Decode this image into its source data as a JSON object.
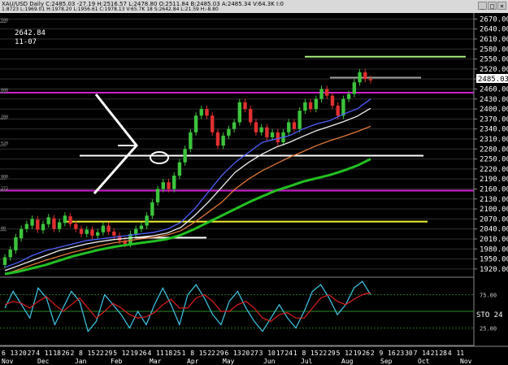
{
  "window": {
    "title": "XAU/USD Daily  C:2485.03  -27.19  H:2516.57  L:2478.80  O:2511.84  B:2485.03  A:2485.34  V:64.3K  I:0",
    "ohlc_line": "1:8723  L:1969.01  H:1978.20  L:1956.61  C:1978.13  V:65.7K  18  S:2642.84  L:21.59  H:-8.80",
    "buttons": [
      "_",
      "□",
      "×"
    ]
  },
  "info": {
    "price": "2642.84",
    "date": "11-07"
  },
  "left_stub_labels": [
    {
      "text": "500",
      "price": 2660
    },
    {
      "text": "808",
      "price": 2450
    },
    {
      "text": "208",
      "price": 2370
    },
    {
      "text": "520",
      "price": 2290
    },
    {
      "text": "900",
      "price": 2190
    },
    {
      "text": "272",
      "price": 2155
    },
    {
      "text": "00",
      "price": 2035
    }
  ],
  "colors": {
    "bg": "#000000",
    "grid": "#2e2e2e",
    "candle_up": "#3cc43c",
    "candle_down": "#e03030",
    "magenta": "#d020d0",
    "yellow": "#f4f430",
    "white": "#ffffff",
    "lime": "#a8f080",
    "gray": "#a0a0a0",
    "ma_green": "#22c022",
    "ma_orange": "#e07838",
    "ma_white": "#f0f0f0",
    "ma_blue": "#5060ff",
    "stoch_cyan": "#40c8e8",
    "stoch_red": "#e02020",
    "axis_text": "#ffffff"
  },
  "chart_data": {
    "type": "candlestick",
    "symbol": "XAU/USD",
    "timeframe": "Daily",
    "price_axis": {
      "ticks": [
        1920,
        1950,
        1980,
        2010,
        2040,
        2070,
        2100,
        2130,
        2160,
        2190,
        2220,
        2250,
        2280,
        2310,
        2340,
        2370,
        2400,
        2430,
        2460,
        2490,
        2520,
        2550,
        2580,
        2610,
        2640,
        2670
      ],
      "ylim": [
        1905,
        2688
      ],
      "last_price": "2485.03"
    },
    "x_axis": {
      "day_labels": [
        "6",
        "13",
        "20",
        "27",
        "4",
        "11",
        "18",
        "26",
        "2",
        "8",
        "15",
        "22",
        "29",
        "5",
        "12",
        "19",
        "26",
        "4",
        "11",
        "18",
        "25",
        "1",
        "8",
        "15",
        "22",
        "29",
        "6",
        "13",
        "20",
        "27",
        "3",
        "10",
        "17",
        "24",
        "1",
        "8",
        "15",
        "22",
        "29",
        "5",
        "12",
        "19",
        "26",
        "2",
        "9",
        "16",
        "23",
        "30",
        "7",
        "14",
        "21",
        "28",
        "4",
        "11"
      ],
      "month_labels": [
        "Nov",
        "Dec",
        "Jan",
        "Feb",
        "Mar",
        "Apr",
        "May",
        "Jun",
        "Jul",
        "Aug",
        "Sep",
        "Oct",
        "Nov"
      ]
    },
    "candles": [
      [
        1932,
        1955
      ],
      [
        1955,
        1978
      ],
      [
        1976,
        2015
      ],
      [
        2012,
        2040
      ],
      [
        2040,
        2055
      ],
      [
        2050,
        2070
      ],
      [
        2068,
        2038
      ],
      [
        2036,
        2055
      ],
      [
        2054,
        2075
      ],
      [
        2072,
        2040
      ],
      [
        2040,
        2060
      ],
      [
        2058,
        2080
      ],
      [
        2078,
        2055
      ],
      [
        2055,
        2040
      ],
      [
        2040,
        2025
      ],
      [
        2025,
        2038
      ],
      [
        2038,
        2020
      ],
      [
        2020,
        2030
      ],
      [
        2030,
        2050
      ],
      [
        2050,
        2032
      ],
      [
        2032,
        2020
      ],
      [
        2020,
        2005
      ],
      [
        2005,
        1995
      ],
      [
        1995,
        2025
      ],
      [
        2025,
        2040
      ],
      [
        2040,
        2050
      ],
      [
        2050,
        2080
      ],
      [
        2080,
        2120
      ],
      [
        2120,
        2160
      ],
      [
        2160,
        2180
      ],
      [
        2180,
        2160
      ],
      [
        2160,
        2200
      ],
      [
        2200,
        2240
      ],
      [
        2240,
        2280
      ],
      [
        2280,
        2330
      ],
      [
        2330,
        2380
      ],
      [
        2380,
        2400
      ],
      [
        2400,
        2380
      ],
      [
        2380,
        2330
      ],
      [
        2330,
        2290
      ],
      [
        2290,
        2320
      ],
      [
        2320,
        2340
      ],
      [
        2340,
        2360
      ],
      [
        2360,
        2420
      ],
      [
        2420,
        2400
      ],
      [
        2400,
        2360
      ],
      [
        2360,
        2330
      ],
      [
        2330,
        2345
      ],
      [
        2345,
        2315
      ],
      [
        2315,
        2330
      ],
      [
        2330,
        2300
      ],
      [
        2300,
        2330
      ],
      [
        2330,
        2360
      ],
      [
        2360,
        2340
      ],
      [
        2340,
        2395
      ],
      [
        2395,
        2420
      ],
      [
        2420,
        2400
      ],
      [
        2400,
        2430
      ],
      [
        2430,
        2460
      ],
      [
        2460,
        2440
      ],
      [
        2440,
        2410
      ],
      [
        2410,
        2380
      ],
      [
        2380,
        2430
      ],
      [
        2430,
        2445
      ],
      [
        2445,
        2480
      ],
      [
        2480,
        2510
      ],
      [
        2510,
        2490
      ],
      [
        2490,
        2486
      ]
    ],
    "moving_averages": [
      {
        "color": "#5060ff",
        "values": [
          1925,
          1940,
          1960,
          1975,
          1985,
          1995,
          2005,
          2010,
          2015,
          2020,
          2025,
          2030,
          2040,
          2060,
          2100,
          2150,
          2200,
          2240,
          2270,
          2300,
          2310,
          2320,
          2340,
          2355,
          2365,
          2385,
          2400,
          2430
        ]
      },
      {
        "color": "#f0f0f0",
        "values": [
          1915,
          1930,
          1945,
          1960,
          1975,
          1985,
          1995,
          2002,
          2008,
          2012,
          2016,
          2020,
          2028,
          2045,
          2080,
          2120,
          2165,
          2210,
          2240,
          2265,
          2285,
          2300,
          2318,
          2335,
          2348,
          2362,
          2378,
          2402
        ]
      },
      {
        "color": "#e07838",
        "values": [
          1905,
          1918,
          1932,
          1946,
          1958,
          1970,
          1980,
          1990,
          1998,
          2004,
          2010,
          2015,
          2022,
          2035,
          2060,
          2090,
          2120,
          2160,
          2190,
          2215,
          2235,
          2255,
          2272,
          2290,
          2305,
          2318,
          2332,
          2348
        ]
      },
      {
        "color": "#22c022",
        "values": [
          1905,
          1912,
          1922,
          1932,
          1945,
          1958,
          1968,
          1978,
          1986,
          1992,
          1998,
          2003,
          2010,
          2022,
          2040,
          2060,
          2080,
          2100,
          2120,
          2138,
          2155,
          2168,
          2182,
          2192,
          2202,
          2215,
          2230,
          2250
        ]
      }
    ],
    "horizontal_levels": [
      {
        "price": 2557,
        "color": "#a8f080",
        "x0": 375,
        "x1": 573
      },
      {
        "price": 2494,
        "color": "#a0a0a0",
        "x0": 406,
        "x1": 518
      },
      {
        "price": 2449,
        "color": "#d020d0",
        "x0": 0,
        "x1": 583
      },
      {
        "price": 2260,
        "color": "#ffffff",
        "x0": 98,
        "x1": 521
      },
      {
        "price": 2155,
        "color": "#d020d0",
        "x0": 0,
        "x1": 583
      },
      {
        "price": 2062,
        "color": "#f4f430",
        "x0": 80,
        "x1": 526
      },
      {
        "price": 2014,
        "color": "#ffffff",
        "x0": 166,
        "x1": 254
      }
    ],
    "stochastic": {
      "label": "STO 24",
      "levels": [
        "75.00",
        "25.00"
      ],
      "k": [
        55,
        80,
        60,
        40,
        85,
        70,
        30,
        55,
        80,
        65,
        20,
        35,
        75,
        60,
        45,
        25,
        50,
        30,
        60,
        85,
        60,
        30,
        75,
        90,
        70,
        45,
        30,
        65,
        80,
        55,
        35,
        20,
        40,
        60,
        40,
        25,
        50,
        80,
        90,
        70,
        45,
        60,
        85,
        95,
        75
      ],
      "d": [
        60,
        65,
        62,
        55,
        65,
        72,
        60,
        50,
        60,
        70,
        55,
        40,
        50,
        62,
        55,
        45,
        40,
        42,
        48,
        60,
        68,
        55,
        55,
        70,
        75,
        65,
        50,
        50,
        60,
        65,
        55,
        40,
        35,
        45,
        48,
        40,
        40,
        55,
        70,
        75,
        65,
        60,
        68,
        75,
        78
      ]
    }
  }
}
